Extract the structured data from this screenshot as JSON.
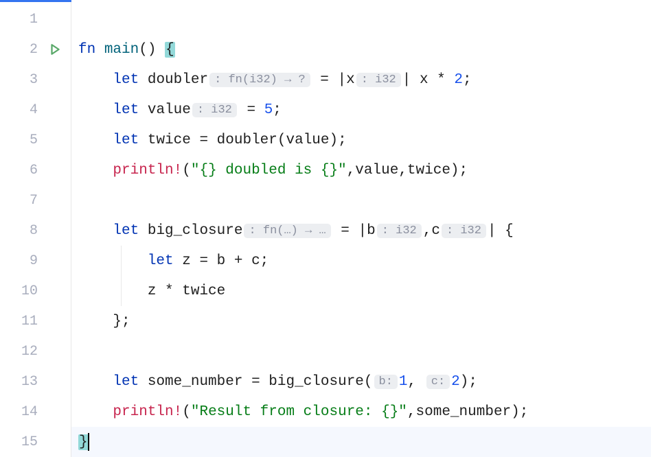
{
  "gutter": {
    "lines": [
      "1",
      "2",
      "3",
      "4",
      "5",
      "6",
      "7",
      "8",
      "9",
      "10",
      "11",
      "12",
      "13",
      "14",
      "15"
    ],
    "run_line": 2
  },
  "code": {
    "l2": {
      "kw_fn": "fn ",
      "name": "main",
      "parens": "()",
      "sp": " ",
      "brace": "{"
    },
    "l3": {
      "indent": "    ",
      "kw_let": "let ",
      "var": "doubler",
      "hint": ": fn(i32) → ?",
      "eq": " = |",
      "param": "x",
      "phint": ": i32",
      "mid": "| ",
      "expr1": "x",
      "op": " * ",
      "num": "2",
      "semi": ";"
    },
    "l4": {
      "indent": "    ",
      "kw_let": "let ",
      "var": "value",
      "hint": ": i32",
      "eq": " = ",
      "num": "5",
      "semi": ";"
    },
    "l5": {
      "indent": "    ",
      "kw_let": "let ",
      "var": "twice",
      "eq": " = ",
      "call": "doubler",
      "args": "(value);"
    },
    "l6": {
      "indent": "    ",
      "macro": "println!",
      "open": "(",
      "str": "\"{} doubled is {}\"",
      "rest": ",value,twice);"
    },
    "l8": {
      "indent": "    ",
      "kw_let": "let ",
      "var": "big_closure",
      "hint": ": fn(…) → …",
      "eq": " = |",
      "p1": "b",
      "h1": ": i32",
      "comma": ",",
      "p2": "c",
      "h2": ": i32",
      "end": "| {"
    },
    "l9": {
      "indent": "        ",
      "kw_let": "let ",
      "var": "z",
      "rest": " = b + c;"
    },
    "l10": {
      "indent": "        ",
      "expr": "z * twice"
    },
    "l11": {
      "indent": "    ",
      "brace": "};"
    },
    "l13": {
      "indent": "    ",
      "kw_let": "let ",
      "var": "some_number",
      "eq": " = ",
      "call": "big_closure",
      "open": "(",
      "h1": "b: ",
      "n1": "1",
      "comma": ", ",
      "h2": "c: ",
      "n2": "2",
      "close": ");"
    },
    "l14": {
      "indent": "    ",
      "macro": "println!",
      "open": "(",
      "str": "\"Result from closure: {}\"",
      "rest": ",some_number);"
    },
    "l15": {
      "brace": "}"
    }
  }
}
